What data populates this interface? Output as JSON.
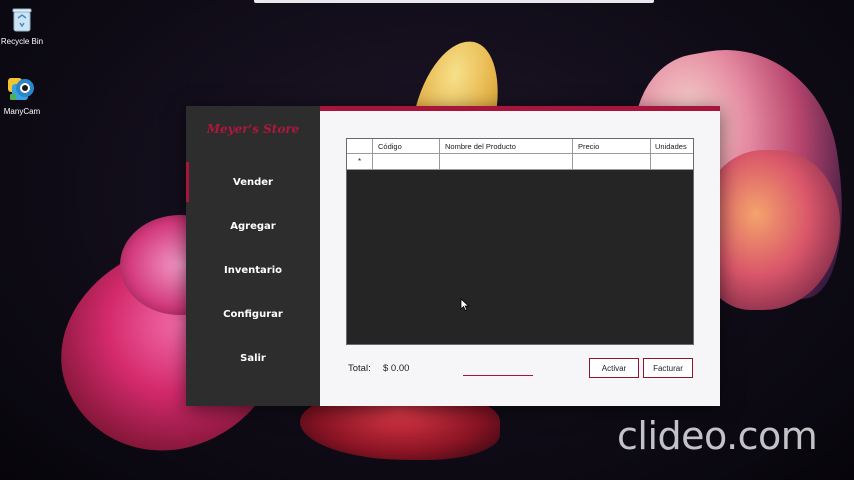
{
  "desktop": {
    "icons": [
      {
        "label": "Recycle Bin",
        "icon": "recycle-bin-icon"
      },
      {
        "label": "ManyCam",
        "icon": "manycam-icon"
      }
    ],
    "watermark": "clideo.com"
  },
  "app": {
    "brand": "Meyer's Store",
    "accent_color": "#a8153a",
    "sidebar_color": "#2d2d2d",
    "nav": [
      {
        "label": "Vender",
        "active": true
      },
      {
        "label": "Agregar",
        "active": false
      },
      {
        "label": "Inventario",
        "active": false
      },
      {
        "label": "Configurar",
        "active": false
      },
      {
        "label": "Salir",
        "active": false
      }
    ],
    "table": {
      "columns": [
        "Código",
        "Nombre del Producto",
        "Precio",
        "Unidades"
      ],
      "new_row_marker": "*",
      "rows": []
    },
    "footer": {
      "total_label": "Total:",
      "total_value": "$ 0.00",
      "activar_label": "Activar",
      "facturar_label": "Facturar"
    }
  }
}
